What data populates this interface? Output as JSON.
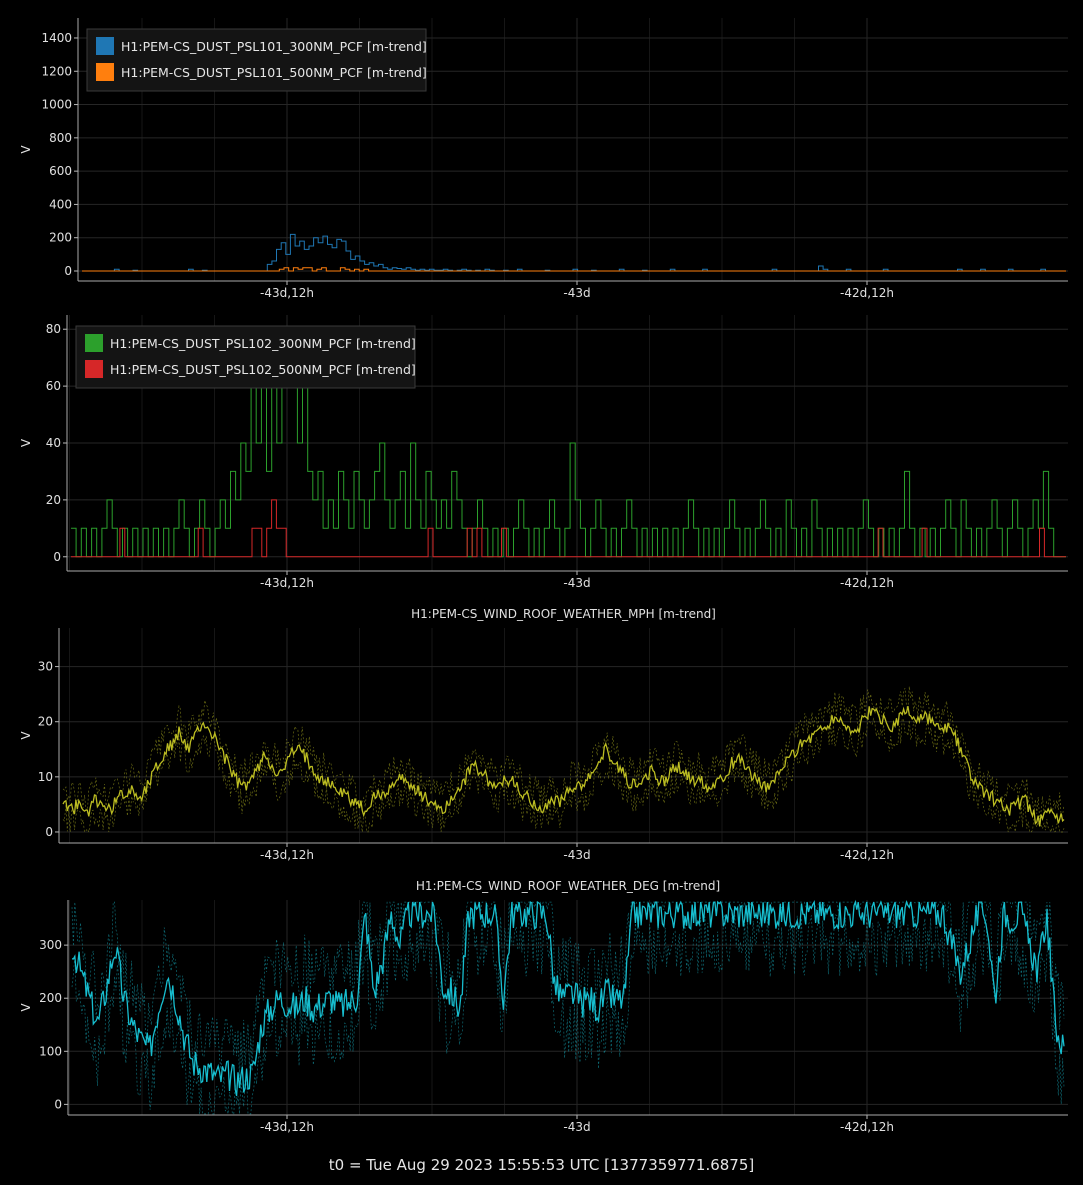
{
  "footer": "t0 = Tue Aug 29 2023 15:55:53 UTC [1377359771.6875]",
  "chart_data": [
    {
      "type": "line",
      "title": "",
      "ylabel": "V",
      "ylim": [
        -60,
        1520
      ],
      "yticks": [
        0,
        200,
        400,
        600,
        800,
        1000,
        1200,
        1400
      ],
      "xticks": [
        "-43d,12h",
        "-43d",
        "-42d,12h"
      ],
      "grid": true,
      "legend": "top-left",
      "series": [
        {
          "name": "H1:PEM-CS_DUST_PSL101_300NM_PCF [m-trend]",
          "color": "#1f77b4",
          "values": [
            0,
            0,
            0,
            0,
            0,
            0,
            0,
            10,
            0,
            0,
            0,
            5,
            0,
            0,
            0,
            0,
            0,
            0,
            0,
            0,
            0,
            0,
            0,
            10,
            0,
            0,
            5,
            0,
            0,
            0,
            0,
            0,
            0,
            0,
            0,
            0,
            0,
            0,
            0,
            0,
            40,
            60,
            130,
            170,
            100,
            220,
            150,
            180,
            130,
            150,
            200,
            170,
            210,
            160,
            140,
            190,
            180,
            120,
            70,
            90,
            60,
            40,
            50,
            30,
            40,
            20,
            10,
            20,
            15,
            10,
            20,
            10,
            5,
            10,
            5,
            10,
            5,
            5,
            10,
            5,
            0,
            5,
            10,
            5,
            0,
            5,
            0,
            10,
            5,
            0,
            0,
            5,
            0,
            0,
            10,
            0,
            0,
            0,
            0,
            0,
            5,
            0,
            0,
            0,
            0,
            0,
            10,
            0,
            0,
            0,
            5,
            0,
            0,
            0,
            0,
            0,
            10,
            0,
            0,
            0,
            0,
            5,
            0,
            0,
            0,
            0,
            0,
            10,
            0,
            0,
            0,
            0,
            0,
            0,
            10,
            0,
            0,
            0,
            0,
            0,
            0,
            0,
            0,
            0,
            0,
            0,
            0,
            0,
            0,
            10,
            0,
            0,
            0,
            0,
            0,
            0,
            0,
            0,
            0,
            30,
            10,
            0,
            0,
            0,
            0,
            10,
            0,
            0,
            0,
            0,
            0,
            0,
            0,
            10,
            0,
            0,
            0,
            0,
            0,
            0,
            0,
            0,
            0,
            0,
            0,
            0,
            0,
            0,
            0,
            10,
            0,
            0,
            0,
            0,
            10,
            0,
            0,
            0,
            0,
            0,
            10,
            0,
            0,
            0,
            0,
            0,
            0,
            10,
            0,
            0,
            0,
            0,
            0
          ]
        },
        {
          "name": "H1:PEM-CS_DUST_PSL101_500NM_PCF [m-trend]",
          "color": "#ff7f0e",
          "values": [
            0,
            0,
            0,
            0,
            0,
            0,
            0,
            0,
            0,
            0,
            0,
            0,
            0,
            0,
            0,
            0,
            0,
            0,
            0,
            0,
            0,
            0,
            0,
            0,
            0,
            0,
            0,
            0,
            0,
            0,
            0,
            0,
            0,
            0,
            0,
            0,
            0,
            0,
            0,
            0,
            0,
            0,
            10,
            20,
            0,
            20,
            10,
            20,
            20,
            0,
            10,
            20,
            0,
            0,
            0,
            20,
            10,
            0,
            10,
            0,
            10,
            0,
            0,
            0,
            0,
            0,
            0,
            0,
            0,
            0,
            0,
            0,
            0,
            0,
            0,
            0,
            0,
            0,
            0,
            0,
            0,
            0,
            0,
            0,
            0,
            0,
            0,
            0,
            0,
            0,
            0,
            0,
            0,
            0,
            0,
            0,
            0,
            0,
            0,
            0,
            0,
            0,
            0,
            0,
            0,
            0,
            0,
            0,
            0,
            0,
            0,
            0,
            0,
            0,
            0,
            0,
            0,
            0,
            0,
            0,
            0,
            0,
            0,
            0,
            0,
            0,
            0,
            0,
            0,
            0,
            0,
            0,
            0,
            0,
            0,
            0,
            0,
            0,
            0,
            0,
            0,
            0,
            0,
            0,
            0,
            0,
            0,
            0,
            0,
            0,
            0,
            0,
            0,
            0,
            0,
            0,
            0,
            0,
            0,
            0,
            0,
            0,
            0,
            0,
            0,
            0,
            0,
            0,
            0,
            0,
            0,
            0,
            0,
            0,
            0,
            0,
            0,
            0,
            0,
            0,
            0,
            0,
            0,
            0,
            0,
            0,
            0,
            0,
            0,
            0,
            0,
            0,
            0,
            0,
            0,
            0,
            0,
            0,
            0,
            0,
            0,
            0,
            0,
            0,
            0,
            0,
            0,
            0,
            0,
            0
          ]
        }
      ]
    },
    {
      "type": "line",
      "title": "",
      "ylabel": "V",
      "ylim": [
        -5,
        85
      ],
      "yticks": [
        0,
        20,
        40,
        60,
        80
      ],
      "xticks": [
        "-43d,12h",
        "-43d",
        "-42d,12h"
      ],
      "grid": true,
      "legend": "top-left",
      "series": [
        {
          "name": "H1:PEM-CS_DUST_PSL102_300NM_PCF [m-trend]",
          "color": "#2ca02c",
          "values": [
            10,
            0,
            10,
            0,
            10,
            0,
            10,
            20,
            10,
            0,
            10,
            0,
            10,
            0,
            10,
            0,
            10,
            0,
            10,
            0,
            10,
            20,
            10,
            0,
            10,
            20,
            10,
            0,
            10,
            20,
            10,
            30,
            20,
            40,
            30,
            70,
            40,
            80,
            30,
            60,
            40,
            70,
            60,
            80,
            40,
            70,
            30,
            20,
            30,
            10,
            20,
            10,
            30,
            20,
            10,
            30,
            20,
            10,
            20,
            30,
            40,
            20,
            10,
            20,
            30,
            10,
            40,
            20,
            10,
            30,
            20,
            10,
            20,
            10,
            30,
            20,
            10,
            0,
            10,
            20,
            10,
            0,
            10,
            0,
            10,
            0,
            10,
            20,
            10,
            0,
            10,
            0,
            10,
            20,
            10,
            0,
            10,
            40,
            20,
            10,
            0,
            10,
            20,
            10,
            0,
            10,
            0,
            10,
            20,
            10,
            0,
            10,
            0,
            10,
            0,
            10,
            0,
            10,
            0,
            10,
            20,
            10,
            0,
            10,
            0,
            10,
            0,
            10,
            20,
            10,
            0,
            10,
            0,
            10,
            20,
            10,
            0,
            10,
            0,
            20,
            10,
            0,
            10,
            0,
            20,
            10,
            0,
            10,
            0,
            10,
            0,
            10,
            0,
            10,
            20,
            10,
            0,
            10,
            0,
            10,
            0,
            10,
            30,
            10,
            0,
            10,
            0,
            10,
            0,
            10,
            20,
            10,
            0,
            20,
            10,
            0,
            10,
            0,
            10,
            20,
            10,
            0,
            10,
            20,
            10,
            0,
            10,
            20,
            10,
            30,
            10,
            0,
            0,
            0
          ]
        },
        {
          "name": "H1:PEM-CS_DUST_PSL102_500NM_PCF [m-trend]",
          "color": "#d62728",
          "values": [
            0,
            0,
            0,
            0,
            0,
            0,
            0,
            0,
            0,
            0,
            10,
            0,
            0,
            0,
            0,
            0,
            0,
            0,
            0,
            0,
            0,
            0,
            0,
            0,
            0,
            0,
            10,
            0,
            0,
            0,
            0,
            0,
            0,
            0,
            0,
            0,
            0,
            10,
            10,
            0,
            10,
            20,
            10,
            10,
            0,
            0,
            0,
            0,
            0,
            0,
            0,
            0,
            0,
            0,
            0,
            0,
            0,
            0,
            0,
            0,
            0,
            0,
            0,
            0,
            0,
            0,
            0,
            0,
            0,
            0,
            0,
            0,
            0,
            10,
            0,
            0,
            0,
            0,
            0,
            0,
            0,
            10,
            0,
            10,
            0,
            0,
            0,
            0,
            10,
            0,
            0,
            0,
            0,
            0,
            0,
            0,
            0,
            0,
            0,
            0,
            0,
            0,
            0,
            0,
            0,
            0,
            0,
            0,
            0,
            0,
            0,
            0,
            0,
            0,
            0,
            0,
            0,
            0,
            0,
            0,
            0,
            0,
            0,
            0,
            0,
            0,
            0,
            0,
            0,
            0,
            0,
            0,
            0,
            0,
            0,
            0,
            0,
            0,
            0,
            0,
            0,
            0,
            0,
            0,
            0,
            0,
            0,
            0,
            0,
            0,
            0,
            0,
            0,
            0,
            0,
            0,
            0,
            0,
            0,
            0,
            0,
            0,
            0,
            0,
            0,
            10,
            0,
            0,
            0,
            0,
            0,
            0,
            0,
            0,
            10,
            0,
            0,
            0,
            0,
            0,
            0,
            0,
            0,
            0,
            0,
            0,
            0,
            0,
            0,
            0,
            0,
            0,
            0,
            0,
            0,
            0,
            0,
            0,
            10,
            0,
            0,
            0,
            0,
            0
          ]
        }
      ]
    },
    {
      "type": "line",
      "title": "H1:PEM-CS_WIND_ROOF_WEATHER_MPH [m-trend]",
      "ylabel": "V",
      "ylim": [
        -2,
        37
      ],
      "yticks": [
        0,
        10,
        20,
        30
      ],
      "xticks": [
        "-43d,12h",
        "-43d",
        "-42d,12h"
      ],
      "grid": true,
      "series": [
        {
          "color": "#bcbd22",
          "band_spread": 5,
          "values": [
            6,
            4,
            5,
            3,
            6,
            5,
            4,
            6,
            7,
            8,
            6,
            9,
            12,
            14,
            16,
            18,
            15,
            17,
            20,
            18,
            16,
            13,
            10,
            8,
            9,
            11,
            14,
            12,
            10,
            13,
            15,
            14,
            12,
            10,
            9,
            8,
            7,
            6,
            5,
            4,
            6,
            7,
            8,
            9,
            10,
            8,
            7,
            6,
            5,
            4,
            6,
            8,
            10,
            12,
            11,
            9,
            8,
            10,
            9,
            7,
            6,
            5,
            4,
            6,
            5,
            7,
            9,
            8,
            10,
            12,
            15,
            13,
            11,
            9,
            8,
            10,
            11,
            9,
            10,
            12,
            11,
            9,
            10,
            8,
            9,
            10,
            12,
            14,
            12,
            10,
            9,
            8,
            10,
            12,
            14,
            16,
            17,
            18,
            19,
            20,
            21,
            19,
            18,
            20,
            22,
            21,
            20,
            19,
            21,
            22,
            20,
            21,
            20,
            18,
            19,
            17,
            14,
            10,
            8,
            7,
            6,
            5,
            4,
            5,
            6,
            3,
            2,
            3,
            3,
            2
          ]
        }
      ]
    },
    {
      "type": "line",
      "title": "H1:PEM-CS_WIND_ROOF_WEATHER_DEG [m-trend]",
      "ylabel": "V",
      "ylim": [
        -20,
        385
      ],
      "yticks": [
        0,
        100,
        200,
        300
      ],
      "xticks": [
        "-43d,12h",
        "-43d",
        "-42d,12h"
      ],
      "grid": true,
      "series": [
        {
          "color": "#17becf",
          "band_spread": 120,
          "values": [
            300,
            250,
            200,
            150,
            220,
            300,
            200,
            150,
            120,
            100,
            180,
            250,
            200,
            130,
            80,
            70,
            60,
            50,
            55,
            45,
            50,
            60,
            150,
            180,
            200,
            190,
            180,
            200,
            180,
            190,
            200,
            185,
            190,
            200,
            360,
            210,
            270,
            360,
            300,
            360,
            360,
            360,
            360,
            220,
            210,
            180,
            360,
            360,
            360,
            360,
            200,
            360,
            360,
            360,
            360,
            360,
            220,
            200,
            210,
            190,
            200,
            180,
            210,
            195,
            200,
            360,
            360,
            360,
            360,
            360,
            360,
            360,
            360,
            360,
            360,
            360,
            360,
            360,
            360,
            360,
            360,
            360,
            360,
            360,
            360,
            360,
            360,
            360,
            360,
            360,
            360,
            360,
            360,
            360,
            360,
            360,
            360,
            360,
            360,
            360,
            360,
            360,
            300,
            250,
            300,
            360,
            360,
            200,
            360,
            350,
            360,
            300,
            250,
            360,
            150,
            100
          ]
        }
      ]
    }
  ]
}
